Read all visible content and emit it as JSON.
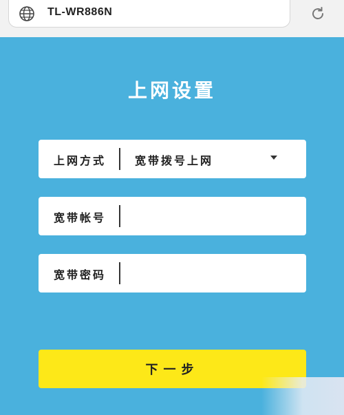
{
  "browser": {
    "url": "TL-WR886N",
    "icons": {
      "site": "globe-icon",
      "reload": "reload-icon"
    }
  },
  "page": {
    "title": "上网设置",
    "background_color": "#4ab1dd",
    "accent_color": "#fde818"
  },
  "form": {
    "connection_type": {
      "label": "上网方式",
      "selected": "宽带拨号上网"
    },
    "account": {
      "label": "宽带帐号",
      "value": ""
    },
    "password": {
      "label": "宽带密码",
      "value": ""
    },
    "next_label": "下一步"
  }
}
